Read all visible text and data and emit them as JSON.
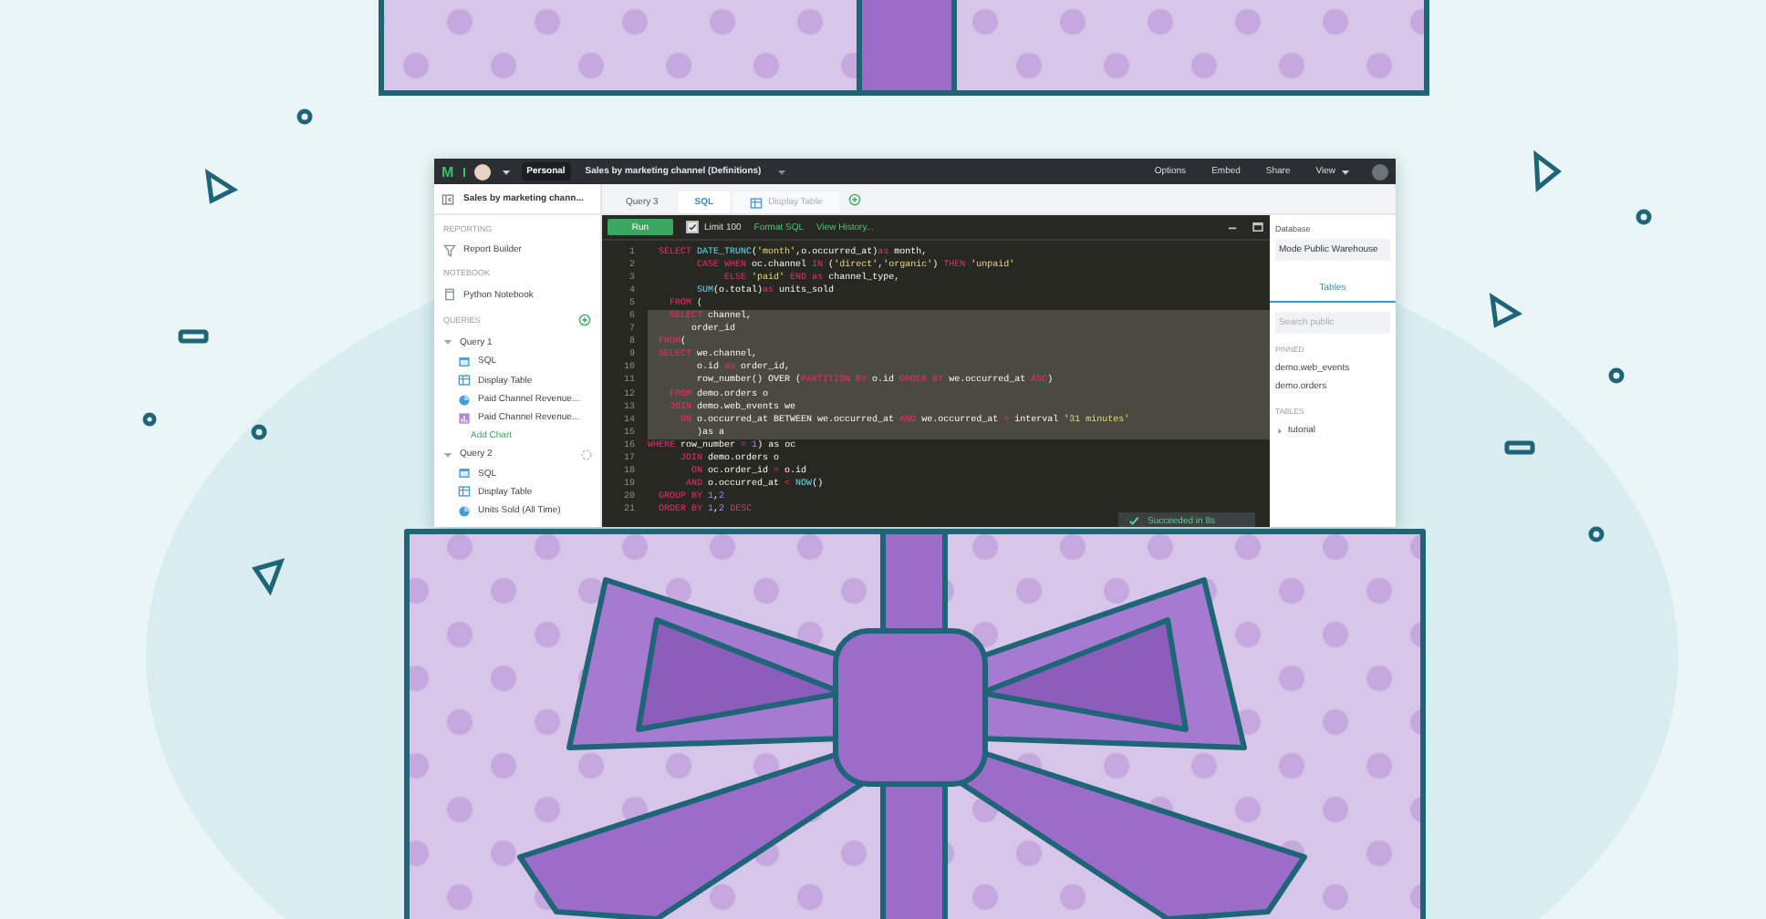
{
  "top_bar": {
    "logo": "M",
    "breadcrumb": [
      {
        "label": "Personal",
        "selected": true
      },
      {
        "label": "Sales by marketing channel (Definitions)",
        "selected": false
      }
    ],
    "menu": [
      {
        "label": "Options",
        "kind": "plain"
      },
      {
        "label": "Embed",
        "kind": "plain"
      },
      {
        "label": "Share",
        "kind": "plain"
      },
      {
        "label": "View",
        "kind": "dropdown"
      }
    ]
  },
  "sidebar": {
    "title": "Sales by marketing chann...",
    "sections": [
      {
        "heading": "REPORTING",
        "items": [
          {
            "label": "Report Builder",
            "kind": "report"
          }
        ]
      },
      {
        "heading": "NOTEBOOK",
        "items": [
          {
            "label": "Python Notebook",
            "kind": "notebook"
          }
        ]
      }
    ],
    "queries": {
      "heading": "QUERIES",
      "items": [
        {
          "label": "Query 1",
          "expanded": true,
          "loading": false,
          "children": [
            {
              "label": "SQL",
              "kind": "sql"
            },
            {
              "label": "Display Table",
              "kind": "table"
            },
            {
              "label": "Paid Channel Revenue...",
              "kind": "pie"
            },
            {
              "label": "Paid Channel Revenue...",
              "kind": "bar"
            },
            {
              "label": "Add Chart",
              "kind": "add"
            }
          ]
        },
        {
          "label": "Query 2",
          "expanded": true,
          "loading": true,
          "children": [
            {
              "label": "SQL",
              "kind": "sql"
            },
            {
              "label": "Display Table",
              "kind": "table"
            },
            {
              "label": "Units Sold (All Time)",
              "kind": "pie"
            }
          ]
        }
      ]
    }
  },
  "tabs": [
    {
      "label": "Query 3",
      "selected": false,
      "kind": "query"
    },
    {
      "label": "SQL",
      "selected": true,
      "kind": "sql"
    },
    {
      "label": "Display Table",
      "selected": false,
      "kind": "table"
    }
  ],
  "toolbar": {
    "run": "Run",
    "limit": {
      "label": "Limit 100",
      "checked": true
    },
    "links": [
      "Format SQL",
      "View History..."
    ]
  },
  "editor": {
    "lines": [
      {
        "number": "1",
        "highlighted": false,
        "tokens": [
          {
            "kind": "kw",
            "text": "  SELECT"
          },
          {
            "kind": "fn",
            "text": " DATE_TRUNC"
          },
          {
            "kind": "txt",
            "text": "("
          },
          {
            "kind": "str",
            "text": "'month'"
          },
          {
            "kind": "txt",
            "text": ",o.occurred_at)"
          },
          {
            "kind": "kw",
            "text": "as"
          },
          {
            "kind": "txt",
            "text": " month,"
          }
        ]
      },
      {
        "number": "2",
        "highlighted": false,
        "tokens": [
          {
            "kind": "kw",
            "text": "         CASE WHEN"
          },
          {
            "kind": "txt",
            "text": " oc.channel "
          },
          {
            "kind": "kw",
            "text": "IN"
          },
          {
            "kind": "txt",
            "text": " ("
          },
          {
            "kind": "str",
            "text": "'direct'"
          },
          {
            "kind": "txt",
            "text": ","
          },
          {
            "kind": "str",
            "text": "'organic'"
          },
          {
            "kind": "txt",
            "text": ") "
          },
          {
            "kind": "kw",
            "text": "THEN"
          },
          {
            "kind": "str",
            "text": " 'unpaid'"
          }
        ]
      },
      {
        "number": "3",
        "highlighted": false,
        "tokens": [
          {
            "kind": "kw",
            "text": "              ELSE"
          },
          {
            "kind": "str",
            "text": " 'paid'"
          },
          {
            "kind": "kw",
            "text": " END"
          },
          {
            "kind": "kw",
            "text": " as"
          },
          {
            "kind": "txt",
            "text": " channel_type,"
          }
        ]
      },
      {
        "number": "4",
        "highlighted": false,
        "tokens": [
          {
            "kind": "fn",
            "text": "         SUM"
          },
          {
            "kind": "txt",
            "text": "(o.total)"
          },
          {
            "kind": "kw",
            "text": "as"
          },
          {
            "kind": "txt",
            "text": " units_sold"
          }
        ]
      },
      {
        "number": "5",
        "highlighted": false,
        "tokens": [
          {
            "kind": "kw",
            "text": "    FROM"
          },
          {
            "kind": "txt",
            "text": " ("
          }
        ]
      },
      {
        "number": "6",
        "highlighted": true,
        "tokens": [
          {
            "kind": "kw",
            "text": "    SELECT"
          },
          {
            "kind": "txt",
            "text": " channel,"
          }
        ]
      },
      {
        "number": "7",
        "highlighted": true,
        "tokens": [
          {
            "kind": "txt",
            "text": "        order_id"
          }
        ]
      },
      {
        "number": "8",
        "highlighted": true,
        "tokens": [
          {
            "kind": "kw",
            "text": "  FROM"
          },
          {
            "kind": "txt",
            "text": "("
          }
        ]
      },
      {
        "number": "9",
        "highlighted": true,
        "tokens": [
          {
            "kind": "kw",
            "text": "  SELECT"
          },
          {
            "kind": "txt",
            "text": " we.channel,"
          }
        ]
      },
      {
        "number": "10",
        "highlighted": true,
        "tokens": [
          {
            "kind": "txt",
            "text": "         o.id "
          },
          {
            "kind": "kw",
            "text": "as"
          },
          {
            "kind": "txt",
            "text": " order_id,"
          }
        ]
      },
      {
        "number": "11",
        "highlighted": true,
        "tokens": [
          {
            "kind": "txt",
            "text": "         row_number() OVER ("
          },
          {
            "kind": "kw",
            "text": "PARTITION BY"
          },
          {
            "kind": "txt",
            "text": " o.id "
          },
          {
            "kind": "kw",
            "text": "ORDER BY"
          },
          {
            "kind": "txt",
            "text": " we.occurred_at "
          },
          {
            "kind": "kw",
            "text": "ASC"
          },
          {
            "kind": "txt",
            "text": ")"
          }
        ]
      },
      {
        "number": "12",
        "highlighted": true,
        "tokens": [
          {
            "kind": "kw",
            "text": "    FROM"
          },
          {
            "kind": "txt",
            "text": " demo.orders o"
          }
        ]
      },
      {
        "number": "13",
        "highlighted": true,
        "tokens": [
          {
            "kind": "kw",
            "text": "    JOIN"
          },
          {
            "kind": "txt",
            "text": " demo.web_events we"
          }
        ]
      },
      {
        "number": "14",
        "highlighted": true,
        "tokens": [
          {
            "kind": "kw",
            "text": "      ON"
          },
          {
            "kind": "txt",
            "text": " o.occurred_at BETWEEN we.occurred_at "
          },
          {
            "kind": "kw",
            "text": "AND"
          },
          {
            "kind": "txt",
            "text": " we.occurred_at "
          },
          {
            "kind": "kw",
            "text": "+"
          },
          {
            "kind": "txt",
            "text": " interval "
          },
          {
            "kind": "str",
            "text": "'31 minutes'"
          }
        ]
      },
      {
        "number": "15",
        "highlighted": true,
        "tokens": [
          {
            "kind": "txt",
            "text": "         )as a"
          }
        ]
      },
      {
        "number": "16",
        "highlighted": false,
        "tokens": [
          {
            "kind": "kw",
            "text": "WHERE"
          },
          {
            "kind": "txt",
            "text": " row_number "
          },
          {
            "kind": "kw",
            "text": "="
          },
          {
            "kind": "num",
            "text": " 1"
          },
          {
            "kind": "txt",
            "text": ") as oc"
          }
        ]
      },
      {
        "number": "17",
        "highlighted": false,
        "tokens": [
          {
            "kind": "kw",
            "text": "      JOIN"
          },
          {
            "kind": "txt",
            "text": " demo.orders o"
          }
        ]
      },
      {
        "number": "18",
        "highlighted": false,
        "tokens": [
          {
            "kind": "kw",
            "text": "        ON"
          },
          {
            "kind": "txt",
            "text": " oc.order_id "
          },
          {
            "kind": "kw",
            "text": "="
          },
          {
            "kind": "txt",
            "text": " o.id"
          }
        ]
      },
      {
        "number": "19",
        "highlighted": false,
        "tokens": [
          {
            "kind": "kw",
            "text": "       AND"
          },
          {
            "kind": "txt",
            "text": " o.occurred_at "
          },
          {
            "kind": "kw",
            "text": "<"
          },
          {
            "kind": "fn",
            "text": " NOW"
          },
          {
            "kind": "txt",
            "text": "()"
          }
        ]
      },
      {
        "number": "20",
        "highlighted": false,
        "tokens": [
          {
            "kind": "kw",
            "text": "  GROUP BY"
          },
          {
            "kind": "num",
            "text": " 1"
          },
          {
            "kind": "txt",
            "text": ","
          },
          {
            "kind": "num",
            "text": "2"
          }
        ]
      },
      {
        "number": "21",
        "highlighted": false,
        "tokens": [
          {
            "kind": "kw",
            "text": "  ORDER BY"
          },
          {
            "kind": "num",
            "text": " 1"
          },
          {
            "kind": "txt",
            "text": ","
          },
          {
            "kind": "num",
            "text": "2"
          },
          {
            "kind": "kw",
            "text": " DESC"
          }
        ]
      }
    ]
  },
  "toast": {
    "kind": "success",
    "text": "Succeeded in 8s"
  },
  "schema": {
    "database_label": "Database",
    "database": "Mode Public Warehouse",
    "tabs": [
      {
        "label": "Tables",
        "selected": true
      }
    ],
    "search": {
      "placeholder": "Search public"
    },
    "groups": [
      {
        "heading": "PINNED",
        "items": [
          {
            "label": "demo.web_events",
            "kind": "table"
          },
          {
            "label": "demo.orders",
            "kind": "table"
          }
        ]
      },
      {
        "heading": "TABLES",
        "items": [
          {
            "label": "tutorial",
            "kind": "folder"
          }
        ]
      }
    ]
  }
}
